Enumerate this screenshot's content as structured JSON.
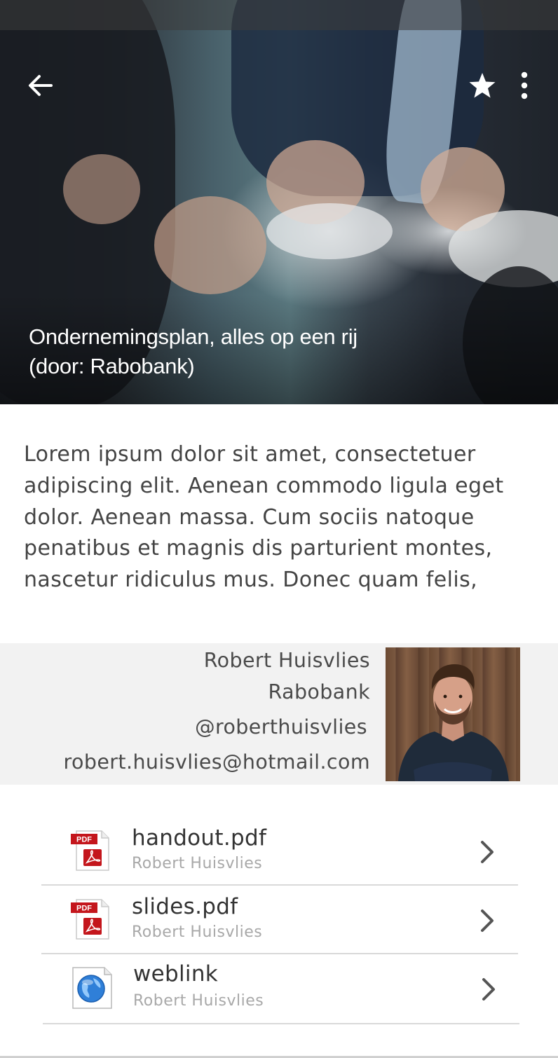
{
  "header": {
    "title_line1": "Ondernemingsplan, alles op een rij",
    "title_line2": "(door: Rabobank)",
    "back_icon": "arrow-left",
    "favorite_icon": "star",
    "menu_icon": "more-vertical"
  },
  "description": "Lorem ipsum dolor sit amet, consectetuer adipiscing elit. Aenean commodo ligula eget dolor. Aenean massa. Cum sociis natoque penatibus et magnis dis parturient montes, nascetur ridiculus mus. Donec quam felis,",
  "author": {
    "name": "Robert Huisvlies",
    "organization": "Rabobank",
    "handle": "@roberthuisvlies",
    "email": "robert.huisvlies@hotmail.com"
  },
  "files": [
    {
      "name": "handout.pdf",
      "author": "Robert Huisvlies",
      "icon": "pdf-icon",
      "icon_label": "PDF"
    },
    {
      "name": "slides.pdf",
      "author": "Robert Huisvlies",
      "icon": "pdf-icon",
      "icon_label": "PDF"
    },
    {
      "name": "weblink",
      "author": "Robert Huisvlies",
      "icon": "globe-icon"
    }
  ],
  "colors": {
    "pdf_red": "#c4161c",
    "text_primary": "#333333",
    "text_secondary": "#a8a8a8",
    "card_background": "#f2f2f2"
  }
}
